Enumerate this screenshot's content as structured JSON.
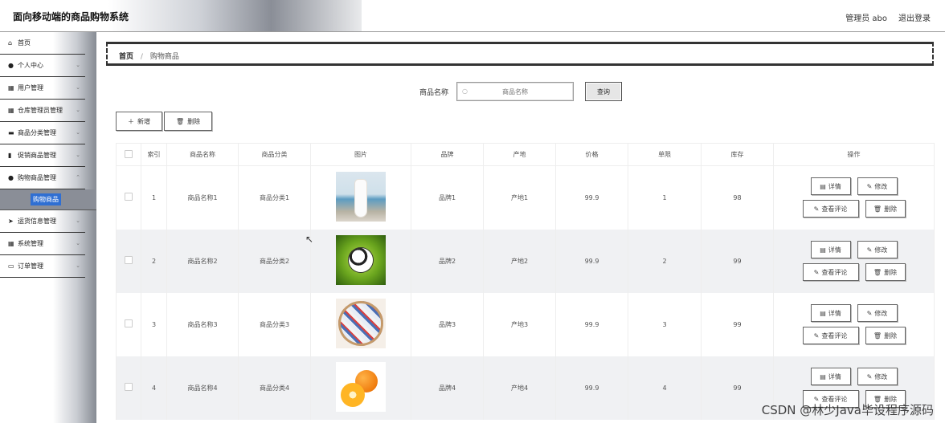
{
  "header": {
    "title": "面向移动端的商品购物系统",
    "user_label": "管理员 abo",
    "logout_label": "退出登录"
  },
  "sidebar": {
    "items": [
      {
        "label": "首页",
        "icon": "home-icon",
        "glyph": "⌂",
        "has_children": false
      },
      {
        "label": "个人中心",
        "icon": "user-icon",
        "glyph": "●",
        "has_children": true
      },
      {
        "label": "用户管理",
        "icon": "grid-icon",
        "glyph": "▦",
        "has_children": true
      },
      {
        "label": "仓库管理员管理",
        "icon": "grid-icon",
        "glyph": "▦",
        "has_children": true
      },
      {
        "label": "商品分类管理",
        "icon": "folder-icon",
        "glyph": "▬",
        "has_children": true
      },
      {
        "label": "促销商品管理",
        "icon": "bar-chart-icon",
        "glyph": "▮",
        "has_children": true
      },
      {
        "label": "购物商品管理",
        "icon": "user-icon",
        "glyph": "●",
        "has_children": true
      },
      {
        "label": "运货信息管理",
        "icon": "send-icon",
        "glyph": "➤",
        "has_children": true
      },
      {
        "label": "系统管理",
        "icon": "grid-icon",
        "glyph": "▦",
        "has_children": true
      },
      {
        "label": "订单管理",
        "icon": "monitor-icon",
        "glyph": "▭",
        "has_children": true
      }
    ],
    "active_sub": "购物商品"
  },
  "breadcrumb": {
    "home": "首页",
    "separator": "/",
    "current": "购物商品"
  },
  "search": {
    "label": "商品名称",
    "placeholder": "商品名称",
    "button": "查询"
  },
  "actions": {
    "add": "新增",
    "delete": "删除"
  },
  "table": {
    "columns": [
      "索引",
      "商品名称",
      "商品分类",
      "图片",
      "品牌",
      "产地",
      "价格",
      "单限",
      "库存",
      "操作"
    ],
    "rows": [
      {
        "index": "1",
        "name": "商品名称1",
        "category": "商品分类1",
        "image": "dress-photo",
        "brand": "品牌1",
        "origin": "产地1",
        "price": "99.9",
        "limit": "1",
        "stock": "98"
      },
      {
        "index": "2",
        "name": "商品名称2",
        "category": "商品分类2",
        "image": "soccer-ball-photo",
        "brand": "品牌2",
        "origin": "产地2",
        "price": "99.9",
        "limit": "2",
        "stock": "99"
      },
      {
        "index": "3",
        "name": "商品名称3",
        "category": "商品分类3",
        "image": "candy-plate-photo",
        "brand": "品牌3",
        "origin": "产地3",
        "price": "99.9",
        "limit": "3",
        "stock": "99"
      },
      {
        "index": "4",
        "name": "商品名称4",
        "category": "商品分类4",
        "image": "oranges-photo",
        "brand": "品牌4",
        "origin": "产地4",
        "price": "99.9",
        "limit": "4",
        "stock": "99"
      }
    ],
    "op_labels": {
      "detail": "详情",
      "edit": "修改",
      "comments": "查看评论",
      "delete": "删除"
    }
  },
  "watermark": "CSDN @林少Java毕设程序源码"
}
